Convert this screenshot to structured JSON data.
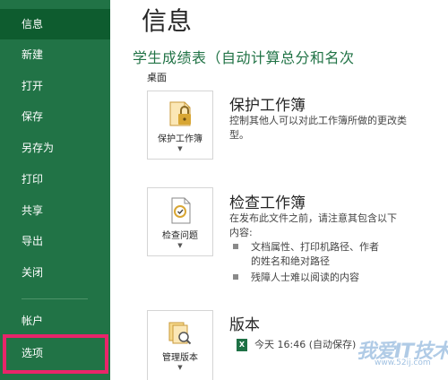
{
  "sidebar": {
    "items": [
      {
        "label": "信息"
      },
      {
        "label": "新建"
      },
      {
        "label": "打开"
      },
      {
        "label": "保存"
      },
      {
        "label": "另存为"
      },
      {
        "label": "打印"
      },
      {
        "label": "共享"
      },
      {
        "label": "导出"
      },
      {
        "label": "关闭"
      },
      {
        "label": "帐户"
      },
      {
        "label": "选项"
      }
    ],
    "active_index": 0
  },
  "header": {
    "title": "信息",
    "document_name": "学生成绩表（自动计算总分和名次",
    "document_location": "桌面"
  },
  "sections": {
    "protect": {
      "button_label": "保护工作簿",
      "heading": "保护工作簿",
      "description": "控制其他人可以对此工作簿所做的更改类型。"
    },
    "inspect": {
      "button_label": "检查问题",
      "heading": "检查工作簿",
      "description": "在发布此文件之前，请注意其包含以下内容:",
      "bullets": [
        "文档属性、打印机路径、作者的姓名和绝对路径",
        "残障人士难以阅读的内容"
      ]
    },
    "versions": {
      "button_label": "管理版本",
      "heading": "版本",
      "entry": "今天 16:46 (自动保存)"
    }
  },
  "watermark": {
    "text": "我爱IT技术网",
    "url": "www.52ij.com"
  },
  "colors": {
    "sidebar_bg": "#217346",
    "sidebar_active": "#0e5c2f",
    "accent_green": "#217346",
    "highlight": "#e8256a"
  }
}
